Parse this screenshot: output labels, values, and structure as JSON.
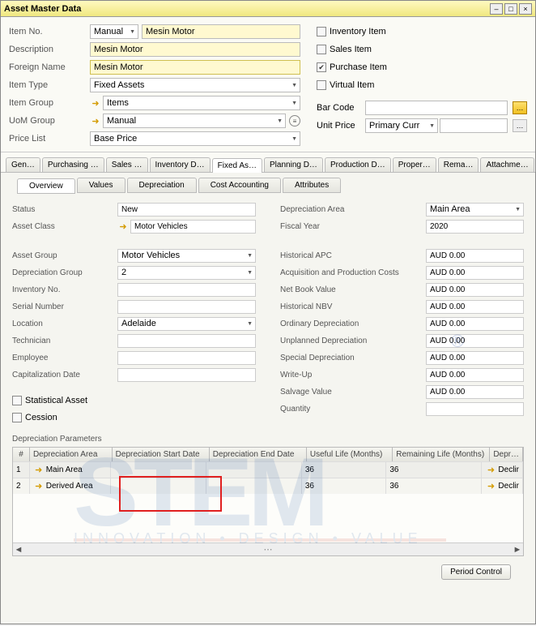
{
  "window": {
    "title": "Asset Master Data"
  },
  "header": {
    "item_no_label": "Item No.",
    "item_no_mode": "Manual",
    "item_no_value": "Mesin Motor",
    "description_label": "Description",
    "description_value": "Mesin Motor",
    "foreign_name_label": "Foreign Name",
    "foreign_name_value": "Mesin Motor",
    "item_type_label": "Item Type",
    "item_type_value": "Fixed Assets",
    "item_group_label": "Item Group",
    "item_group_value": "Items",
    "uom_group_label": "UoM Group",
    "uom_group_value": "Manual",
    "price_list_label": "Price List",
    "price_list_value": "Base Price",
    "bar_code_label": "Bar Code",
    "unit_price_label": "Unit Price",
    "unit_price_currency": "Primary Curr",
    "chk_inventory": "Inventory Item",
    "chk_sales": "Sales Item",
    "chk_purchase": "Purchase Item",
    "chk_virtual": "Virtual Item"
  },
  "tabs": [
    "Gen…",
    "Purchasing …",
    "Sales …",
    "Inventory D…",
    "Fixed As…",
    "Planning D…",
    "Production D…",
    "Proper…",
    "Rema…",
    "Attachme…"
  ],
  "subtabs": [
    "Overview",
    "Values",
    "Depreciation",
    "Cost Accounting",
    "Attributes"
  ],
  "overview": {
    "status_label": "Status",
    "status_value": "New",
    "asset_class_label": "Asset Class",
    "asset_class_value": "Motor Vehicles",
    "asset_group_label": "Asset Group",
    "asset_group_value": "Motor Vehicles",
    "dep_group_label": "Depreciation Group",
    "dep_group_value": "2",
    "inventory_no_label": "Inventory No.",
    "serial_no_label": "Serial Number",
    "location_label": "Location",
    "location_value": "Adelaide",
    "technician_label": "Technician",
    "employee_label": "Employee",
    "cap_date_label": "Capitalization Date",
    "chk_statistical": "Statistical Asset",
    "chk_cession": "Cession",
    "right": {
      "dep_area_label": "Depreciation Area",
      "dep_area_value": "Main Area",
      "fiscal_year_label": "Fiscal Year",
      "fiscal_year_value": "2020",
      "rows": [
        {
          "label": "Historical APC",
          "value": "AUD 0.00"
        },
        {
          "label": "Acquisition and Production Costs",
          "value": "AUD 0.00"
        },
        {
          "label": "Net Book Value",
          "value": "AUD 0.00"
        },
        {
          "label": "Historical NBV",
          "value": "AUD 0.00"
        },
        {
          "label": "Ordinary Depreciation",
          "value": "AUD 0.00"
        },
        {
          "label": "Unplanned Depreciation",
          "value": "AUD 0.00"
        },
        {
          "label": "Special Depreciation",
          "value": "AUD 0.00"
        },
        {
          "label": "Write-Up",
          "value": "AUD 0.00"
        },
        {
          "label": "Salvage Value",
          "value": "AUD 0.00"
        },
        {
          "label": "Quantity",
          "value": ""
        }
      ]
    },
    "dep_params_label": "Depreciation Parameters",
    "grid_headers": [
      "#",
      "Depreciation Area",
      "Depreciation Start Date",
      "Depreciation End Date",
      "Useful Life (Months)",
      "Remaining Life (Months)",
      "Depr…"
    ],
    "grid_rows": [
      {
        "n": "1",
        "area": "Main Area",
        "start": "",
        "end": "",
        "useful": "36",
        "remain": "36",
        "dep": "Declir"
      },
      {
        "n": "2",
        "area": "Derived Area",
        "start": "",
        "end": "",
        "useful": "36",
        "remain": "36",
        "dep": "Declir"
      }
    ]
  },
  "footer": {
    "period_control": "Period Control"
  },
  "watermark": {
    "big": "STEM",
    "small": "INNOVATION • DESIGN • VALUE",
    "reg": "®"
  }
}
